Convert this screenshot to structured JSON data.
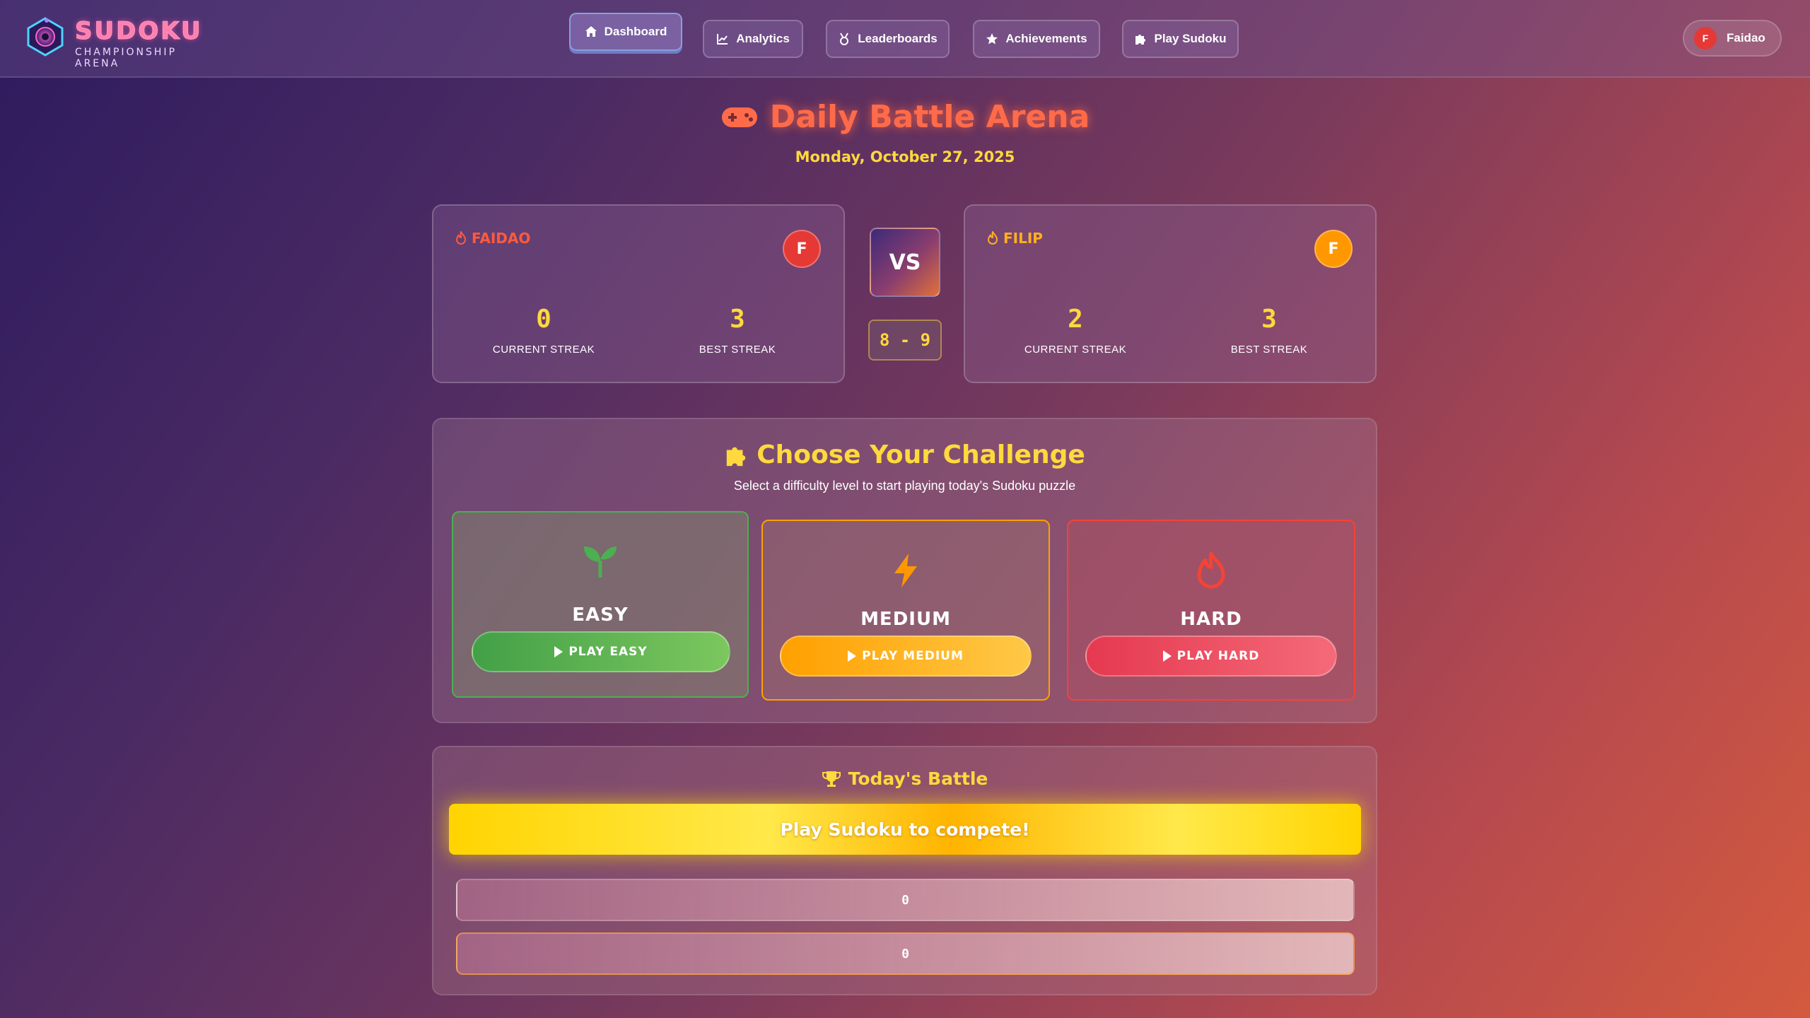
{
  "brand": {
    "title": "SUDOKU",
    "subtitle": "CHAMPIONSHIP ARENA"
  },
  "nav": {
    "items": [
      {
        "label": "Dashboard",
        "icon": "home-icon",
        "active": true
      },
      {
        "label": "Analytics",
        "icon": "chart-icon",
        "active": false
      },
      {
        "label": "Leaderboards",
        "icon": "medal-icon",
        "active": false
      },
      {
        "label": "Achievements",
        "icon": "star-icon",
        "active": false
      },
      {
        "label": "Play Sudoku",
        "icon": "puzzle-icon",
        "active": false
      }
    ]
  },
  "user": {
    "initial": "F",
    "name": "Faidao"
  },
  "hero": {
    "title": "Daily Battle Arena",
    "date": "Monday, October 27, 2025"
  },
  "players": [
    {
      "name": "FAIDAO",
      "initial": "F",
      "current_streak": "0",
      "best_streak": "3",
      "color": "#e53935",
      "name_color": "#ff5a3c"
    },
    {
      "name": "FILIP",
      "initial": "F",
      "current_streak": "2",
      "best_streak": "3",
      "color": "#ff9800",
      "name_color": "#ffb020"
    }
  ],
  "stat_labels": {
    "current": "CURRENT STREAK",
    "best": "BEST STREAK"
  },
  "versus": {
    "label": "VS",
    "score": "8 - 9"
  },
  "challenge": {
    "title": "Choose Your Challenge",
    "subtitle": "Select a difficulty level to start playing today's Sudoku puzzle",
    "levels": [
      {
        "name": "EASY",
        "button": "PLAY EASY",
        "icon": "sprout-icon",
        "color": "#4caf50"
      },
      {
        "name": "MEDIUM",
        "button": "PLAY MEDIUM",
        "icon": "lightning-icon",
        "color": "#ffa000"
      },
      {
        "name": "HARD",
        "button": "PLAY HARD",
        "icon": "fire-icon",
        "color": "#f44336"
      }
    ]
  },
  "battle": {
    "title": "Today's Battle",
    "banner": "Play Sudoku to compete!",
    "bars": [
      {
        "value": "0"
      },
      {
        "value": "0"
      }
    ]
  }
}
